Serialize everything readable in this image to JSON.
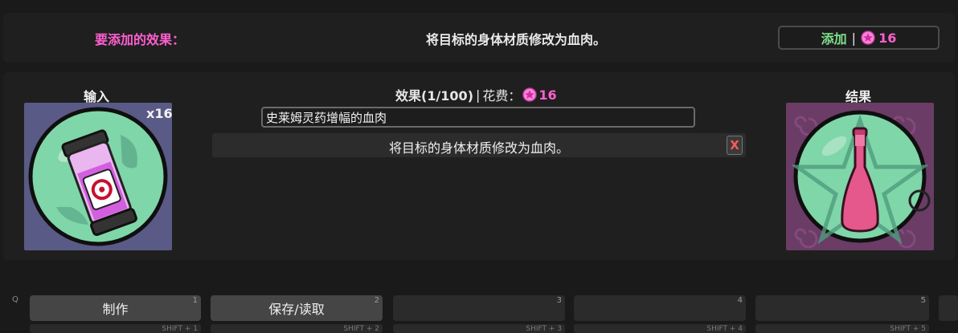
{
  "top": {
    "label": "要添加的效果：",
    "description": "将目标的身体材质修改为血肉。",
    "add_button": {
      "label": "添加",
      "cost": "16"
    }
  },
  "input": {
    "title": "输入",
    "quantity": "x16"
  },
  "result": {
    "title": "结果"
  },
  "effect": {
    "header": "效果(1/100)",
    "cost_label": "花费：",
    "cost": "16",
    "name_value": "史莱姆灵药增幅的血肉",
    "row_text": "将目标的身体材质修改为血肉。",
    "remove_label": "X"
  },
  "hotbar": {
    "q_label": "Q",
    "slots": [
      {
        "label": "制作",
        "num": "1",
        "shift": "SHIFT + 1"
      },
      {
        "label": "保存/读取",
        "num": "2",
        "shift": "SHIFT + 2"
      },
      {
        "label": "",
        "num": "3",
        "shift": "SHIFT + 3"
      },
      {
        "label": "",
        "num": "4",
        "shift": "SHIFT + 4"
      },
      {
        "label": "",
        "num": "5",
        "shift": "SHIFT + 5"
      }
    ]
  },
  "colors": {
    "pink": "#ff5fd0",
    "green": "#7fe08a",
    "input_bg": "#5a5a86",
    "result_bg": "#6a3c66"
  }
}
